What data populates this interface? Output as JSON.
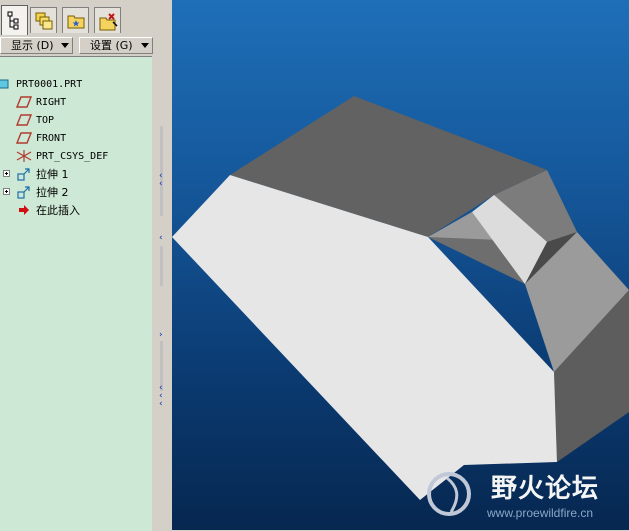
{
  "toolbar": {
    "tabs": [
      {
        "icon": "model-tree-icon",
        "active": true
      },
      {
        "icon": "layers-icon",
        "active": false
      },
      {
        "icon": "favorites-folder-icon",
        "active": false
      },
      {
        "icon": "connections-icon",
        "active": false
      }
    ],
    "display_label": "显示 (D)",
    "settings_label": "设置 (G)"
  },
  "tree": {
    "root": "PRT0001.PRT",
    "items": [
      {
        "label": "RIGHT",
        "icon": "datum-plane-icon",
        "expandable": false
      },
      {
        "label": "TOP",
        "icon": "datum-plane-icon",
        "expandable": false
      },
      {
        "label": "FRONT",
        "icon": "datum-plane-icon",
        "expandable": false
      },
      {
        "label": "PRT_CSYS_DEF",
        "icon": "coordinate-system-icon",
        "expandable": false
      },
      {
        "label": "拉伸 1",
        "icon": "extrude-icon",
        "expandable": true
      },
      {
        "label": "拉伸 2",
        "icon": "extrude-icon",
        "expandable": true
      },
      {
        "label": "在此插入",
        "icon": "insert-here-arrow-icon",
        "expandable": false
      }
    ]
  },
  "watermark": {
    "title": "野火论坛",
    "url": "www.proewildfire.cn"
  }
}
